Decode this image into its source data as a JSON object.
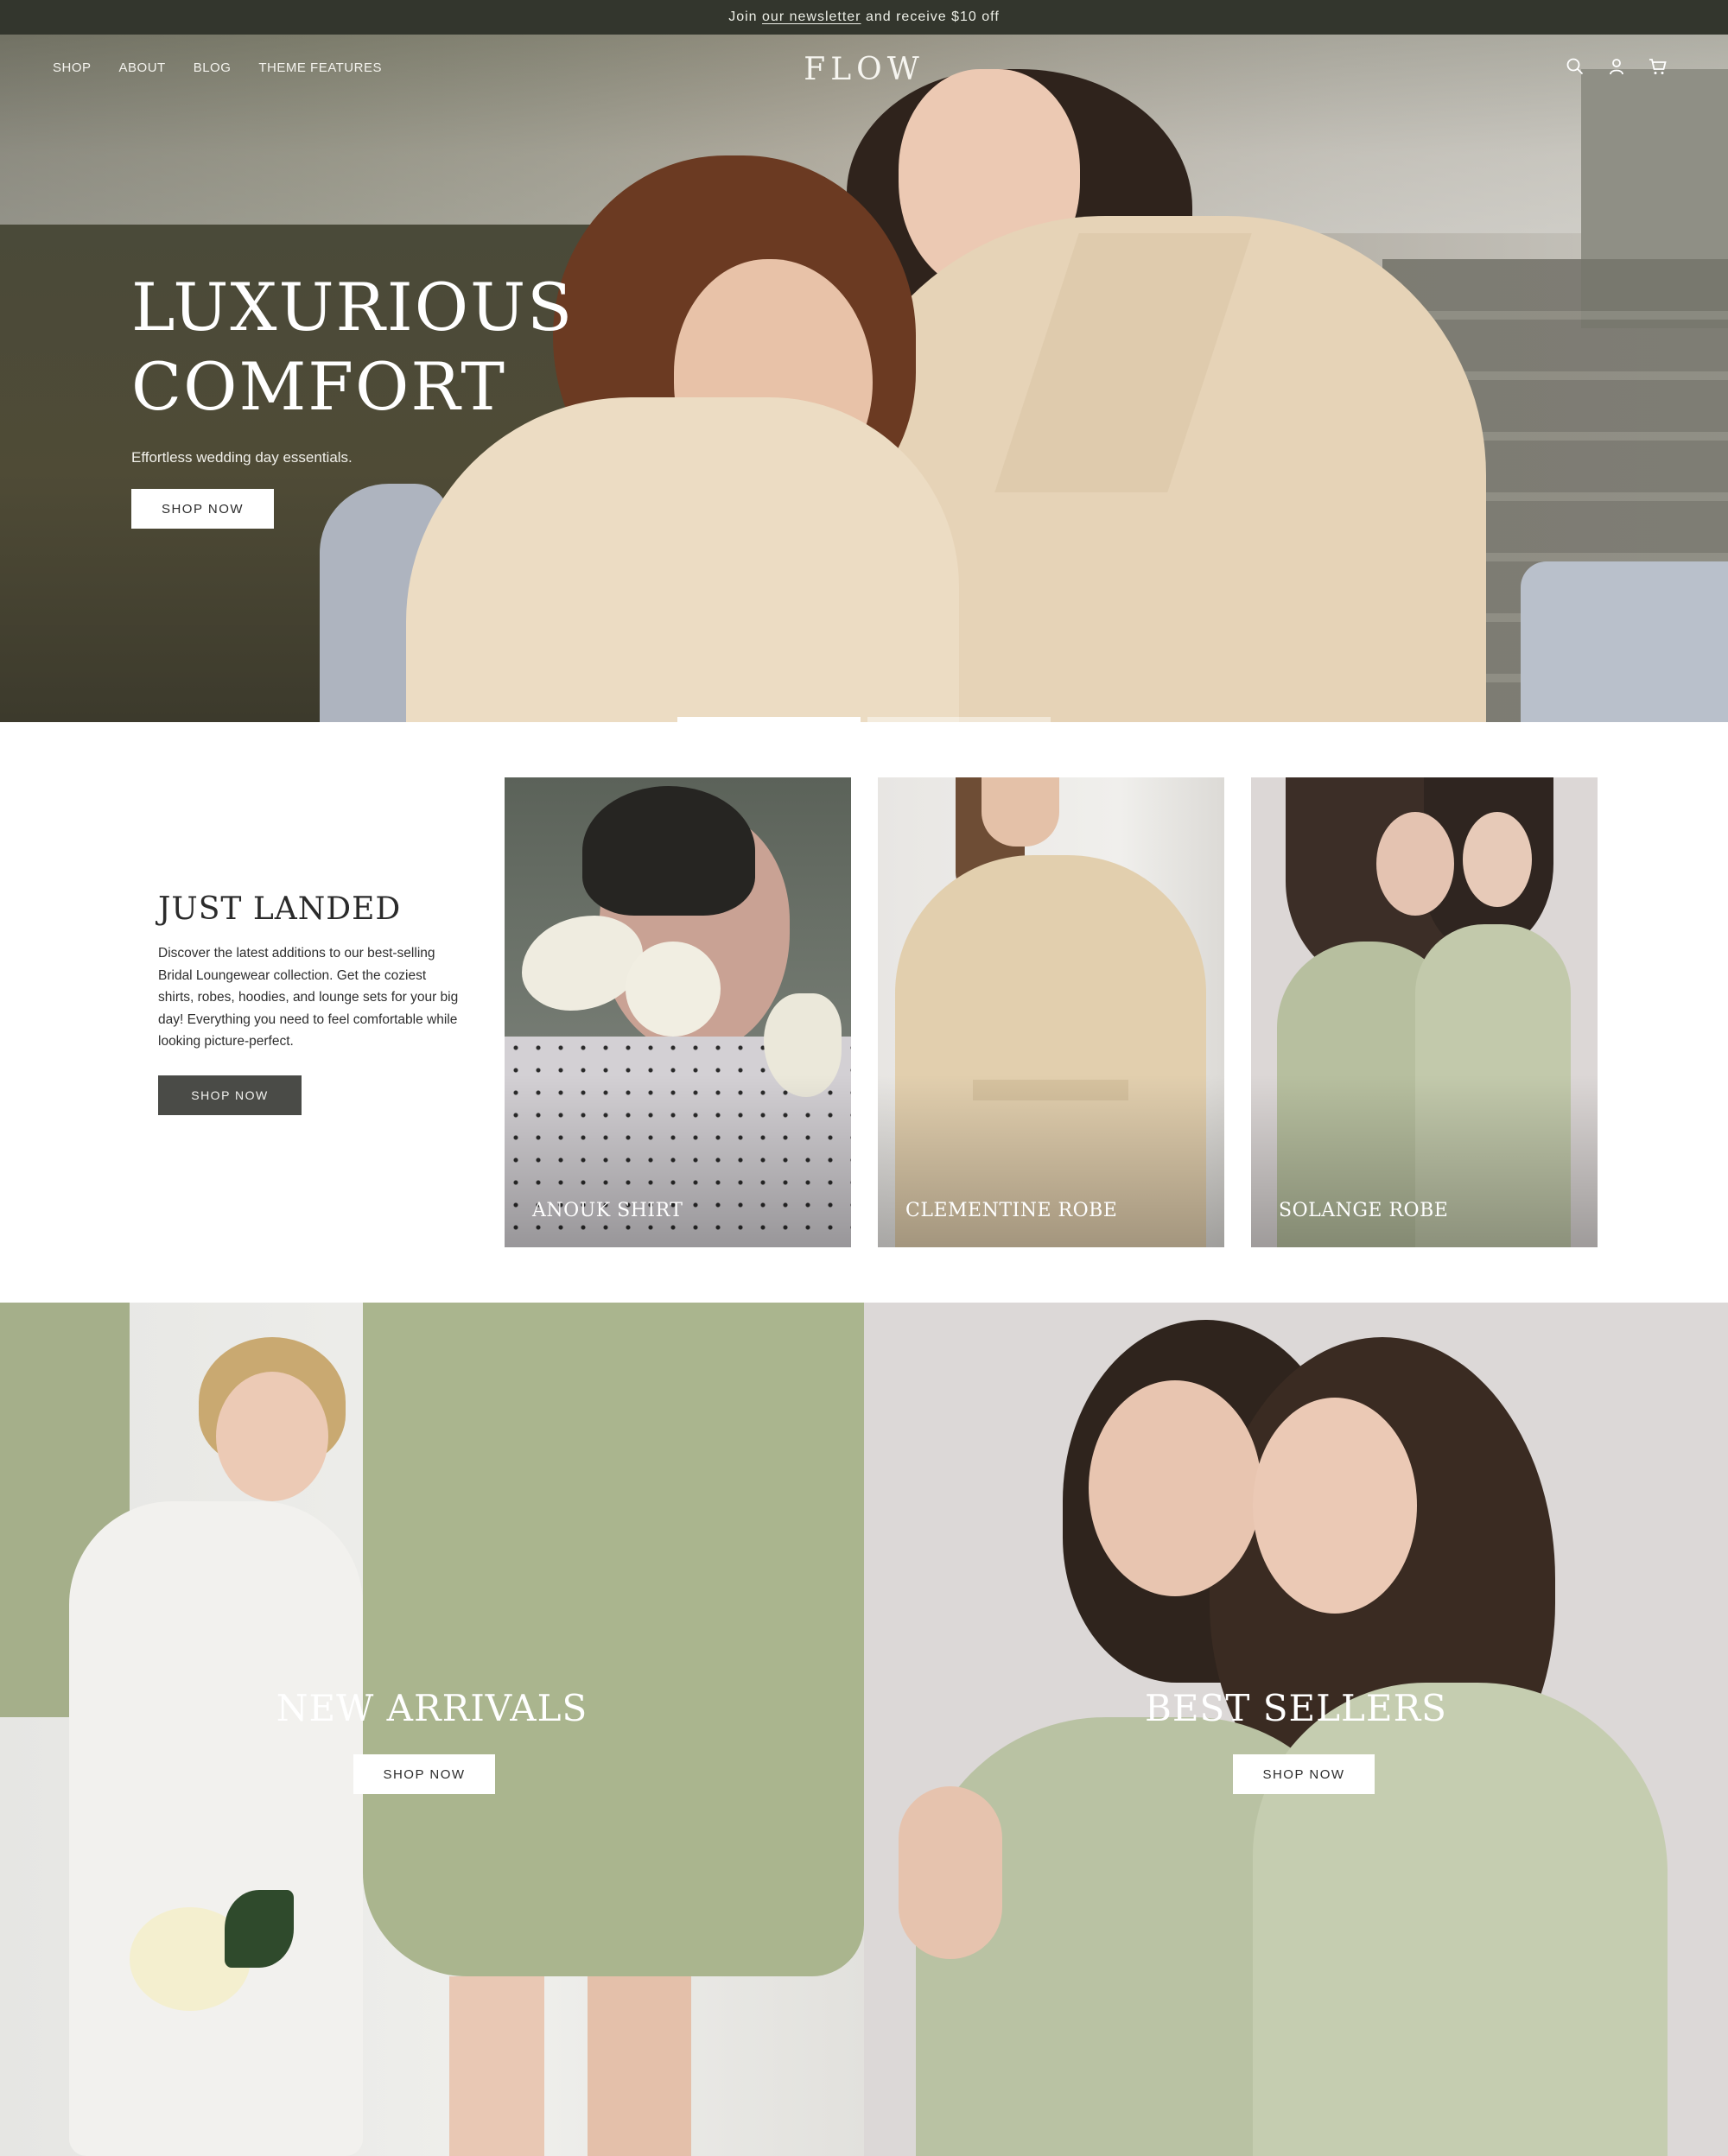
{
  "announcement": {
    "prefix": "Join ",
    "link": "our newsletter",
    "suffix": " and receive $10 off"
  },
  "header": {
    "menu": [
      "SHOP",
      "ABOUT",
      "BLOG",
      "THEME FEATURES"
    ],
    "logo": "FLOW",
    "icons": [
      "search-icon",
      "account-icon",
      "cart-icon"
    ]
  },
  "hero": {
    "title": "LUXURIOUS\nCOMFORT",
    "subtitle": "Effortless wedding day essentials.",
    "cta": "SHOP NOW",
    "slides": 2,
    "active_slide": 1
  },
  "just_landed": {
    "title": "JUST LANDED",
    "description": "Discover the latest additions to our best-selling Bridal Loungewear collection. Get the coziest shirts, robes, hoodies, and lounge sets for your big day! Everything you need to feel comfortable while looking picture-perfect.",
    "cta": "SHOP NOW",
    "products": [
      {
        "name": "ANOUK SHIRT"
      },
      {
        "name": "CLEMENTINE ROBE"
      },
      {
        "name": "SOLANGE ROBE"
      }
    ]
  },
  "promos": [
    {
      "heading": "NEW ARRIVALS",
      "cta": "SHOP NOW"
    },
    {
      "heading": "BEST SELLERS",
      "cta": "SHOP NOW"
    }
  ],
  "colors": {
    "announcement_bg": "#33362d",
    "dark_button": "#4a4b47",
    "sage": "#a9b48f",
    "beige": "#e6d3b7"
  }
}
